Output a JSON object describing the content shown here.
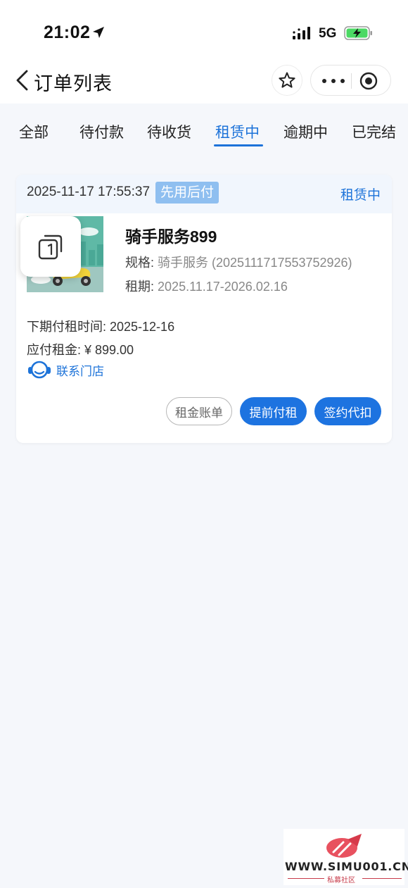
{
  "status_bar": {
    "time": "21:02",
    "network": "5G"
  },
  "nav": {
    "title": "订单列表"
  },
  "tabs": [
    {
      "label": "全部",
      "active": false
    },
    {
      "label": "待付款",
      "active": false
    },
    {
      "label": "待收货",
      "active": false
    },
    {
      "label": "租赁中",
      "active": true
    },
    {
      "label": "逾期中",
      "active": false
    },
    {
      "label": "已完结",
      "active": false
    }
  ],
  "order": {
    "time": "2025-11-17 17:55:37",
    "pay_badge": "先用后付",
    "status": "租赁中",
    "product_name": "骑手服务899",
    "spec_label": "规格:",
    "spec_value": "骑手服务 (20251117175537529​26)",
    "term_label": "租期:",
    "term_value": "2025.11.17-2026.02.16",
    "next_pay": "下期付租时间: 2025-12-16",
    "due": "应付租金: ¥ 899.00",
    "contact": "联系门店",
    "buttons": {
      "bill": "租金账单",
      "prepay": "提前付租",
      "sign": "签约代扣"
    }
  },
  "watermark": {
    "url": "WWW.SIMU001.CN",
    "sub": "私募社区"
  },
  "colors": {
    "accent": "#1d73d9",
    "badge": "#8fbff0",
    "head_bg": "#f1f6fd"
  }
}
